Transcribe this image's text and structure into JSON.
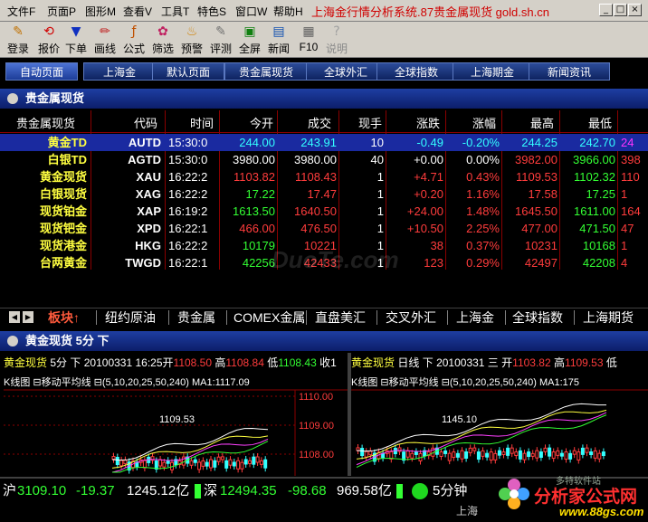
{
  "menu": [
    "文件F",
    "页面P",
    "图形M",
    "查看V",
    "工具T",
    "特色S",
    "窗口W",
    "帮助H"
  ],
  "app_title": "上海金行情分析系统.87贵金属现货 gold.sh.cn",
  "window_buttons": [
    "_",
    "□",
    "×"
  ],
  "toolbar": [
    {
      "label": "登录",
      "icon": "login-icon"
    },
    {
      "label": "报价",
      "icon": "quote-icon"
    },
    {
      "label": "下单",
      "icon": "order-icon"
    },
    {
      "label": "画线",
      "icon": "draw-icon"
    },
    {
      "label": "公式",
      "icon": "formula-icon"
    },
    {
      "label": "筛选",
      "icon": "filter-icon"
    },
    {
      "label": "预警",
      "icon": "alert-icon"
    },
    {
      "label": "评测",
      "icon": "evaluate-icon"
    },
    {
      "label": "全屏",
      "icon": "fullscreen-icon"
    },
    {
      "label": "新闻",
      "icon": "news-icon"
    },
    {
      "label": "F10",
      "icon": "f10-icon"
    },
    {
      "label": "说明",
      "icon": "help-icon"
    }
  ],
  "page_tabs": [
    "自动页面",
    "上海金",
    "默认页面",
    "贵金属现货",
    "全球外汇",
    "全球指数",
    "上海期金",
    "新闻资讯"
  ],
  "active_page_tab": "自动页面",
  "quote_panel_title": "贵金属现货",
  "quote_table": {
    "columns": [
      "贵金属现货",
      "代码",
      "时间",
      "今开",
      "成交",
      "现手",
      "涨跌",
      "涨幅",
      "最高",
      "最低",
      ""
    ],
    "rows": [
      {
        "name": "黄金TD",
        "code": "AUTD",
        "time": "15:30:0",
        "open": "244.00",
        "last": "243.91",
        "vol": "10",
        "chg": "-0.49",
        "pct": "-0.20%",
        "high": "244.25",
        "low": "242.70",
        "extra": "24"
      },
      {
        "name": "白银TD",
        "code": "AGTD",
        "time": "15:30:0",
        "open": "3980.00",
        "last": "3980.00",
        "vol": "40",
        "chg": "+0.00",
        "pct": "0.00%",
        "high": "3982.00",
        "low": "3966.00",
        "extra": "398"
      },
      {
        "name": "黄金现货",
        "code": "XAU",
        "time": "16:22:2",
        "open": "1103.82",
        "last": "1108.43",
        "vol": "1",
        "chg": "+4.71",
        "pct": "0.43%",
        "high": "1109.53",
        "low": "1102.32",
        "extra": "110"
      },
      {
        "name": "白银现货",
        "code": "XAG",
        "time": "16:22:2",
        "open": "17.22",
        "last": "17.47",
        "vol": "1",
        "chg": "+0.20",
        "pct": "1.16%",
        "high": "17.58",
        "low": "17.25",
        "extra": "1"
      },
      {
        "name": "现货铂金",
        "code": "XAP",
        "time": "16:19:2",
        "open": "1613.50",
        "last": "1640.50",
        "vol": "1",
        "chg": "+24.00",
        "pct": "1.48%",
        "high": "1645.50",
        "low": "1611.00",
        "extra": "164"
      },
      {
        "name": "现货钯金",
        "code": "XPD",
        "time": "16:22:1",
        "open": "466.00",
        "last": "476.50",
        "vol": "1",
        "chg": "+10.50",
        "pct": "2.25%",
        "high": "477.00",
        "low": "471.50",
        "extra": "47"
      },
      {
        "name": "现货港金",
        "code": "HKG",
        "time": "16:22:2",
        "open": "10179",
        "last": "10221",
        "vol": "1",
        "chg": "38",
        "pct": "0.37%",
        "high": "10231",
        "low": "10168",
        "extra": "1"
      },
      {
        "name": "台两黄金",
        "code": "TWGD",
        "time": "16:22:1",
        "open": "42256",
        "last": "42433",
        "vol": "1",
        "chg": "123",
        "pct": "0.29%",
        "high": "42497",
        "low": "42208",
        "extra": "4"
      }
    ]
  },
  "watermark_text": "DuoTe.com",
  "quote_tabs": [
    "板块↑",
    "纽约原油",
    "贵金属",
    "COMEX金属",
    "直盘美汇",
    "交叉外汇",
    "上海金",
    "全球指数",
    "上海期货"
  ],
  "chart_section_title": "黄金现货 5分 下",
  "chart_left": {
    "header_name": "黄金现货",
    "header_period": "5分",
    "header_dir": "下",
    "header_time": "20100331 16:25",
    "open_label": "开",
    "open": "1108.50",
    "high_label": "高",
    "high": "1108.84",
    "low_label": "低",
    "low": "1108.43",
    "close_label": "收1",
    "sub": "K线图 ⊟移动平均线 ⊟(5,10,20,25,50,240) MA1:1117.09",
    "peak_label": "1109.53",
    "y_ticks": [
      "1110.00",
      "1109.00",
      "1108.00"
    ]
  },
  "chart_right": {
    "header_name": "黄金现货",
    "header_period": "日线",
    "header_dir": "下",
    "header_time": "20100331 三",
    "open_label": "开",
    "open": "1103.82",
    "high_label": "高",
    "high": "1109.53",
    "low_label": "低",
    "sub": "K线图 ⊟移动平均线 ⊟(5,10,20,25,50,240) MA1:175",
    "peak_label": "1145.10"
  },
  "status_bar": {
    "sh_label": "沪",
    "sh_index": "3109.10",
    "sh_chg": "-19.37",
    "sh_amt": "1245.12亿",
    "sz_label": "深",
    "sz_index": "12494.35",
    "sz_chg": "-98.68",
    "sz_amt": "969.58亿",
    "period": "5分钟",
    "bottom": "上海"
  },
  "logo": {
    "brand": "分析家公式网",
    "url": "www.88gs.com",
    "small": "多特软件站"
  },
  "colors": {
    "up": "#ff3c3c",
    "down": "#33ff33",
    "neutral": "#ffffff",
    "name": "#ffff40",
    "code": "#ffffff",
    "accent": "#d00000"
  }
}
